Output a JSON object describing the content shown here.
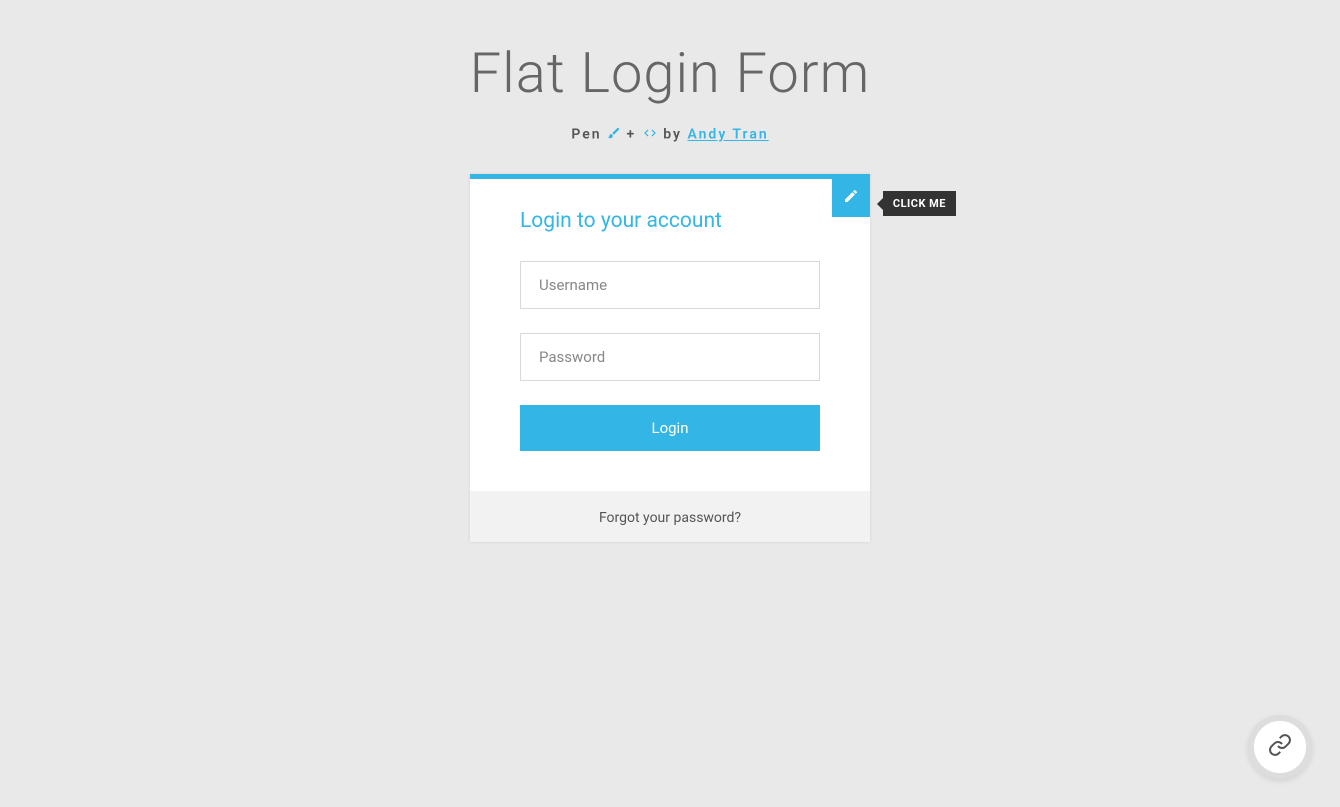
{
  "header": {
    "title": "Flat Login Form",
    "subtitle_prefix": "Pen ",
    "subtitle_plus": " + ",
    "subtitle_by": " by ",
    "author": "Andy Tran"
  },
  "toggle": {
    "tooltip": "CLICK ME"
  },
  "form": {
    "heading": "Login to your account",
    "username_placeholder": "Username",
    "password_placeholder": "Password",
    "submit_label": "Login"
  },
  "cta": {
    "forgot_label": "Forgot your password?"
  },
  "colors": {
    "accent": "#33b5e5",
    "background": "#e9e9e9"
  }
}
